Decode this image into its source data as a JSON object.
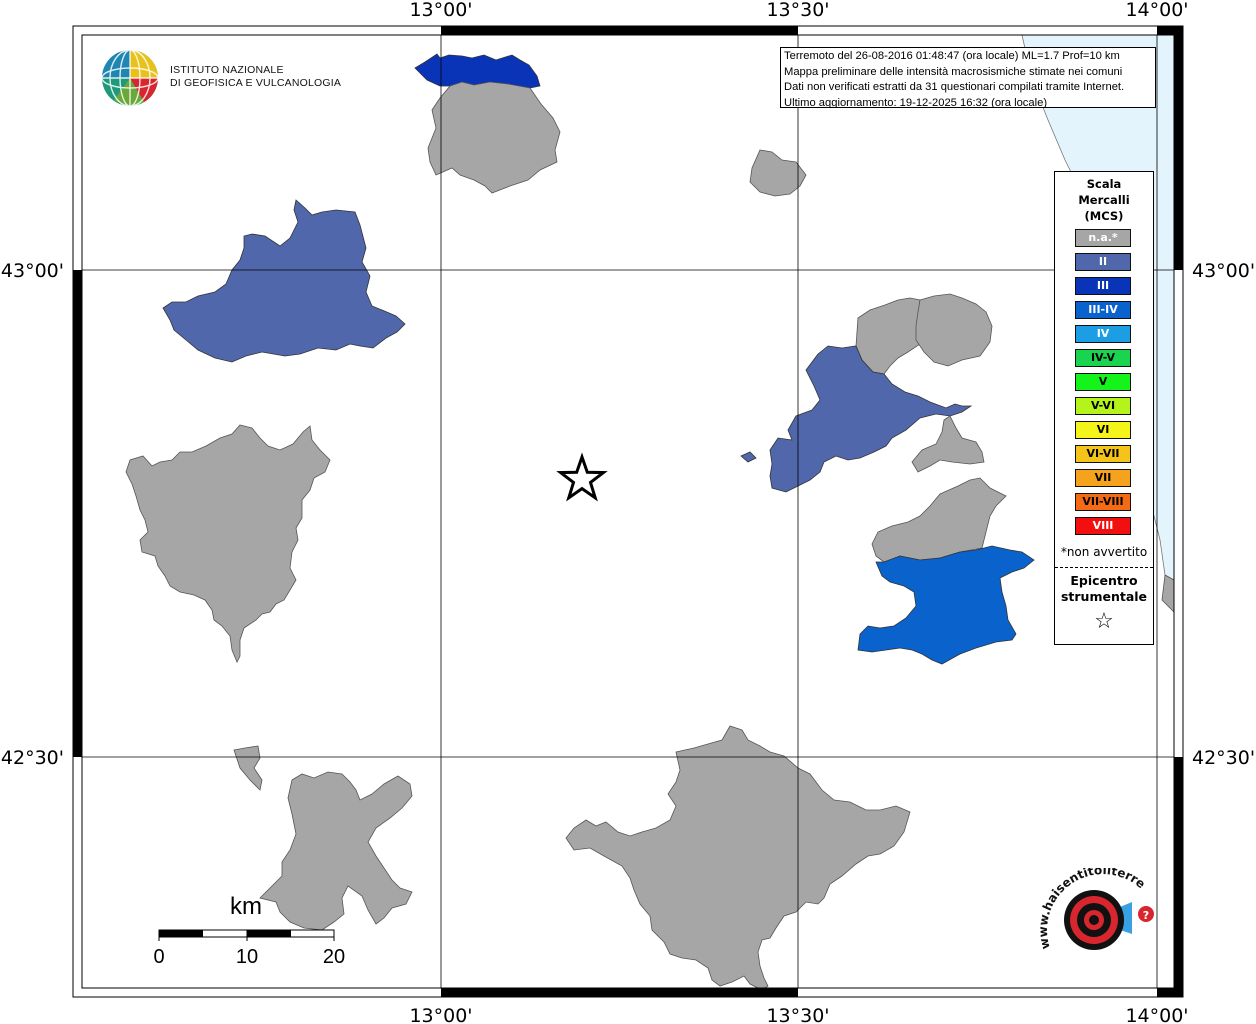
{
  "map": {
    "top_lon_labels": [
      "13°00'",
      "13°30'",
      "14°00'"
    ],
    "bottom_lon_labels": [
      "13°00'",
      "13°30'",
      "14°00'"
    ],
    "left_lat_labels": [
      "43°00'",
      "42°30'"
    ],
    "right_lat_labels": [
      "43°00'",
      "42°30'"
    ],
    "sea_color": "#e3f4fd",
    "not_felt_color": "#a6a6a6",
    "epicenter_symbol": "☆"
  },
  "info_box": {
    "lines": [
      "Terremoto del 26-08-2016 01:48:47 (ora locale) ML=1.7 Prof=10 km",
      "Mappa preliminare delle intensità macrosismiche stimate nei comuni",
      "Dati non verificati estratti da 31 questionari compilati tramite Internet.",
      "Ultimo aggiornamento: 19-12-2025 16:32 (ora locale)"
    ]
  },
  "legend": {
    "title_lines": [
      "Scala",
      "Mercalli",
      "(MCS)"
    ],
    "items": [
      {
        "label": "n.a.*",
        "color": "#a6a6a6",
        "text_color": "#ffffff"
      },
      {
        "label": "II",
        "color": "#5067ac",
        "text_color": "#ffffff"
      },
      {
        "label": "III",
        "color": "#0a34b8",
        "text_color": "#ffffff"
      },
      {
        "label": "III-IV",
        "color": "#0a62cc",
        "text_color": "#ffffff"
      },
      {
        "label": "IV",
        "color": "#1c9ee4",
        "text_color": "#ffffff"
      },
      {
        "label": "IV-V",
        "color": "#1ad34f",
        "text_color": "#000000"
      },
      {
        "label": "V",
        "color": "#14f31a",
        "text_color": "#000000"
      },
      {
        "label": "V-VI",
        "color": "#b5f41a",
        "text_color": "#000000"
      },
      {
        "label": "VI",
        "color": "#f4f41a",
        "text_color": "#000000"
      },
      {
        "label": "VI-VII",
        "color": "#f4c41a",
        "text_color": "#000000"
      },
      {
        "label": "VII",
        "color": "#f5a21c",
        "text_color": "#000000"
      },
      {
        "label": "VII-VIII",
        "color": "#f56b14",
        "text_color": "#000000"
      },
      {
        "label": "VIII",
        "color": "#f20f0f",
        "text_color": "#ffffff"
      }
    ],
    "note": "*non avvertito",
    "epicenter_title_lines": [
      "Epicentro",
      "strumentale"
    ],
    "epicenter_symbol": "☆"
  },
  "scalebar": {
    "unit": "km",
    "ticks": [
      "0",
      "10",
      "20"
    ]
  },
  "logos": {
    "ingv_lines": [
      "ISTITUTO NAZIONALE",
      "DI GEOFISICA E VULCANOLOGIA"
    ],
    "hsit_text": "www.haisentitoilterremoto.it"
  }
}
